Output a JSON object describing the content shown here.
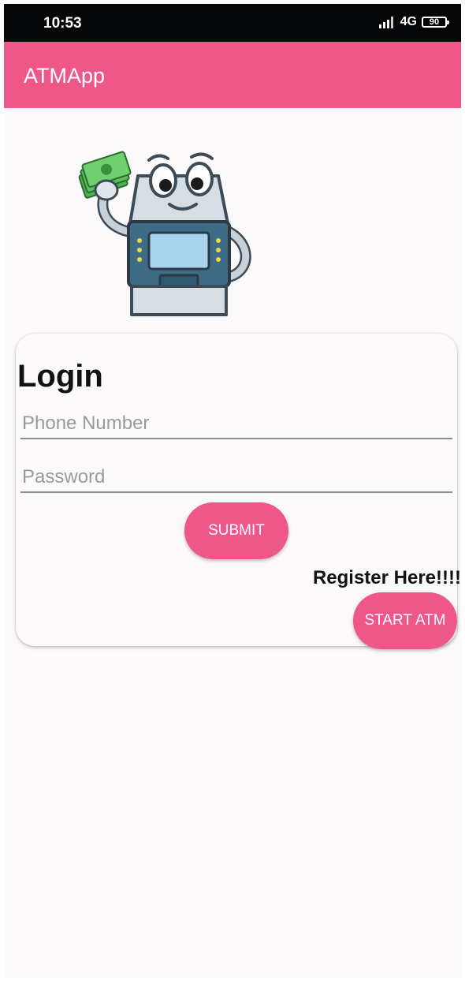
{
  "status_bar": {
    "time": "10:53",
    "network": "4G",
    "battery": "90"
  },
  "app_bar": {
    "title": "ATMApp",
    "color": "#ef5789"
  },
  "login": {
    "title": "Login",
    "phone_placeholder": "Phone Number",
    "phone_value": "",
    "password_placeholder": "Password",
    "password_value": "",
    "submit_label": "SUBMIT",
    "register_text": "Register Here!!!!",
    "start_label": "START ATM"
  },
  "icons": {
    "signal": "signal-icon",
    "battery": "battery-icon",
    "mascot": "atm-mascot-icon"
  }
}
